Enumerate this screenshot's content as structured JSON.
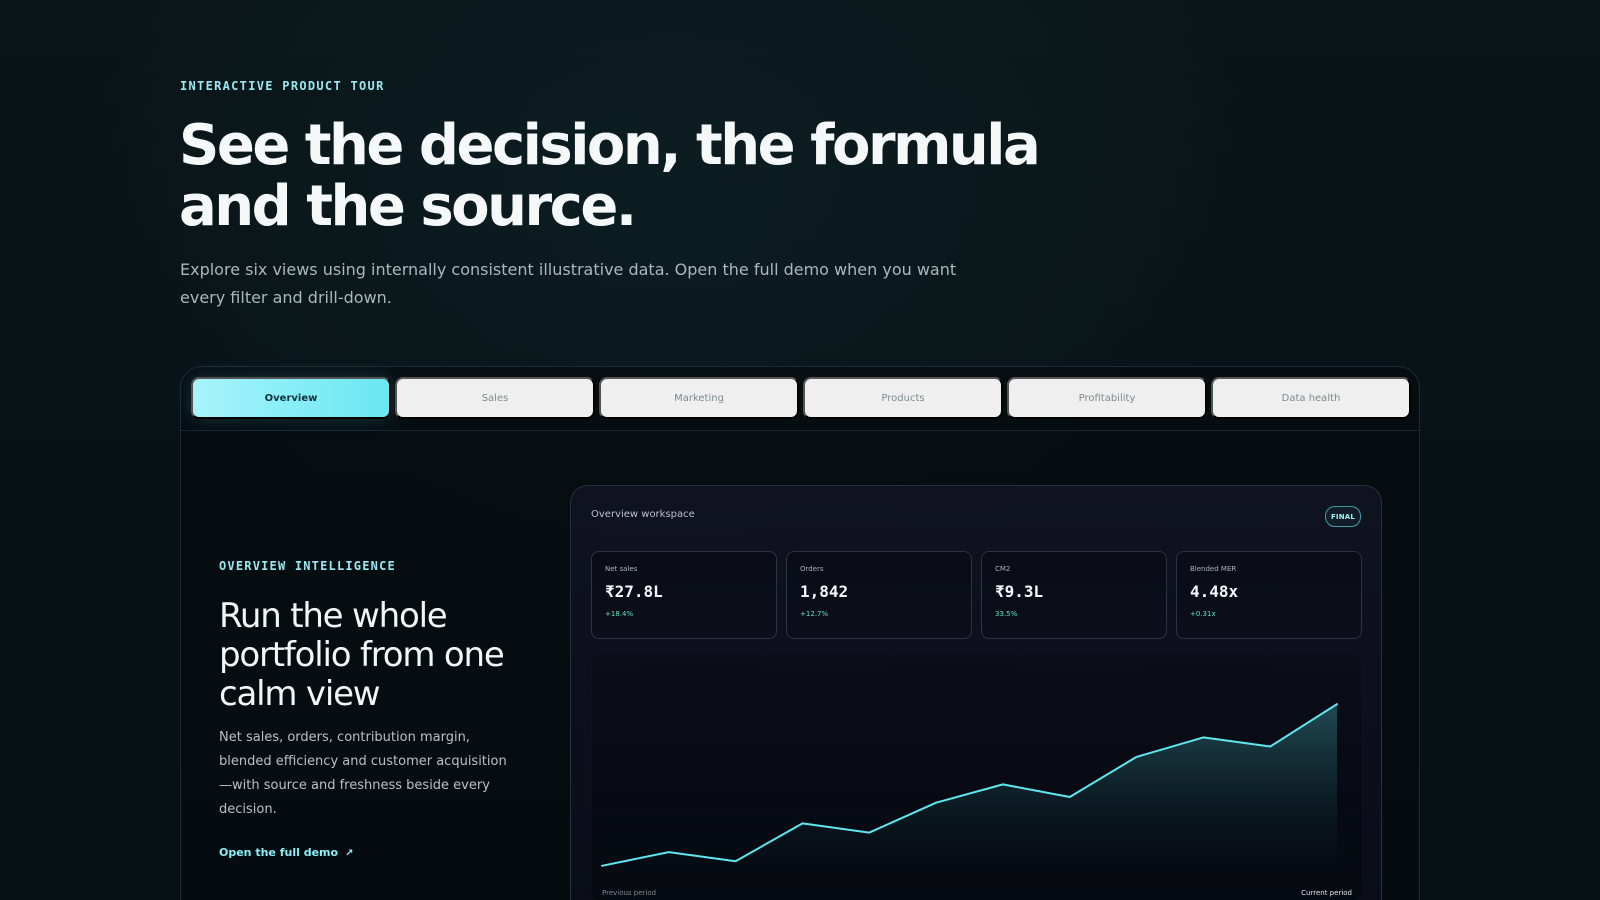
{
  "hero": {
    "eyebrow": "INTERACTIVE PRODUCT TOUR",
    "title_lines": [
      "See the decision, the formula",
      "and the source."
    ],
    "subtitle_lines": [
      "Explore six views using internally consistent illustrative data. Open the full demo when you want",
      "every filter and drill-down."
    ]
  },
  "tabs": [
    {
      "label": "Overview",
      "active": true
    },
    {
      "label": "Sales",
      "active": false
    },
    {
      "label": "Marketing",
      "active": false
    },
    {
      "label": "Products",
      "active": false
    },
    {
      "label": "Profitability",
      "active": false
    },
    {
      "label": "Data health",
      "active": false
    }
  ],
  "overview": {
    "eyebrow": "OVERVIEW INTELLIGENCE",
    "title_lines": [
      "Run the whole",
      "portfolio from one",
      "calm view"
    ],
    "body_lines": [
      "Net sales, orders, contribution margin,",
      "blended efficiency and customer acquisition",
      "—with source and freshness beside every",
      "decision."
    ],
    "cta": "Open the full demo",
    "cta_icon": "↗"
  },
  "workspace": {
    "title": "Overview workspace",
    "badge": "FINAL",
    "kpis": [
      {
        "label": "Net sales",
        "value": "₹27.8L",
        "delta": "+18.4%"
      },
      {
        "label": "Orders",
        "value": "1,842",
        "delta": "+12.7%"
      },
      {
        "label": "CM2",
        "value": "₹9.3L",
        "delta": "33.5%"
      },
      {
        "label": "Blended MER",
        "value": "4.48x",
        "delta": "+0.31x"
      }
    ]
  },
  "chart_data": {
    "type": "area",
    "values": [
      8,
      20,
      12,
      45,
      37,
      63,
      79,
      68,
      103,
      120,
      112,
      149
    ],
    "ylim": [
      0,
      170
    ],
    "series_color": "#5ee7ef",
    "footer_left": "Previous period",
    "footer_right": "Current period"
  },
  "colors": {
    "accent": "#8aeff7",
    "positive": "#5ee4b5",
    "background": "#081216"
  }
}
